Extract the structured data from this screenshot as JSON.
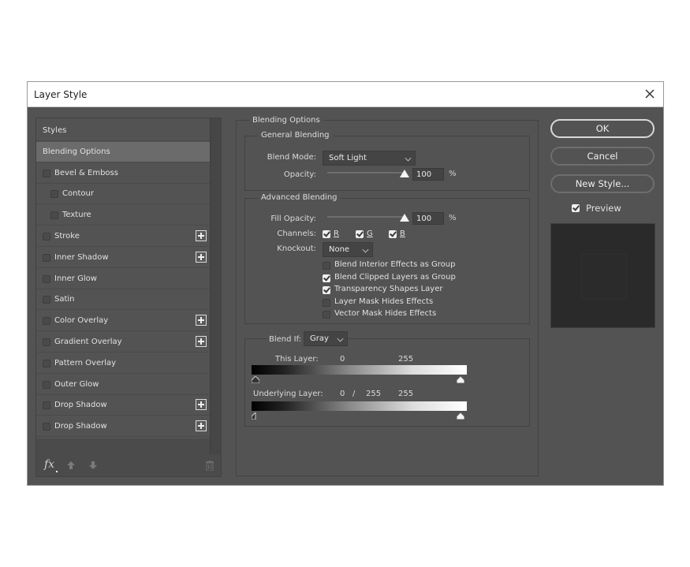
{
  "window": {
    "title": "Layer Style",
    "close_icon": "close-icon"
  },
  "styles_panel": {
    "items": [
      {
        "label": "Styles",
        "checkbox": false,
        "checked": false,
        "plus": false,
        "indent": 0,
        "selected": false
      },
      {
        "label": "Blending Options",
        "checkbox": false,
        "checked": false,
        "plus": false,
        "indent": 0,
        "selected": true
      },
      {
        "label": "Bevel & Emboss",
        "checkbox": true,
        "checked": false,
        "plus": false,
        "indent": 0,
        "selected": false
      },
      {
        "label": "Contour",
        "checkbox": true,
        "checked": false,
        "plus": false,
        "indent": 1,
        "selected": false
      },
      {
        "label": "Texture",
        "checkbox": true,
        "checked": false,
        "plus": false,
        "indent": 1,
        "selected": false
      },
      {
        "label": "Stroke",
        "checkbox": true,
        "checked": false,
        "plus": true,
        "indent": 0,
        "selected": false
      },
      {
        "label": "Inner Shadow",
        "checkbox": true,
        "checked": false,
        "plus": true,
        "indent": 0,
        "selected": false
      },
      {
        "label": "Inner Glow",
        "checkbox": true,
        "checked": false,
        "plus": false,
        "indent": 0,
        "selected": false
      },
      {
        "label": "Satin",
        "checkbox": true,
        "checked": false,
        "plus": false,
        "indent": 0,
        "selected": false
      },
      {
        "label": "Color Overlay",
        "checkbox": true,
        "checked": false,
        "plus": true,
        "indent": 0,
        "selected": false
      },
      {
        "label": "Gradient Overlay",
        "checkbox": true,
        "checked": false,
        "plus": true,
        "indent": 0,
        "selected": false
      },
      {
        "label": "Pattern Overlay",
        "checkbox": true,
        "checked": false,
        "plus": false,
        "indent": 0,
        "selected": false
      },
      {
        "label": "Outer Glow",
        "checkbox": true,
        "checked": false,
        "plus": false,
        "indent": 0,
        "selected": false
      },
      {
        "label": "Drop Shadow",
        "checkbox": true,
        "checked": false,
        "plus": true,
        "indent": 0,
        "selected": false
      },
      {
        "label": "Drop Shadow",
        "checkbox": true,
        "checked": false,
        "plus": true,
        "indent": 0,
        "selected": false
      }
    ],
    "footer": {
      "fx_label": "fx",
      "move_up_icon": "arrow-up-icon",
      "move_down_icon": "arrow-down-icon",
      "delete_icon": "trash-icon"
    }
  },
  "blending_options": {
    "legend": "Blending Options",
    "general": {
      "legend": "General Blending",
      "blend_mode_label": "Blend Mode:",
      "blend_mode_value": "Soft Light",
      "opacity_label": "Opacity:",
      "opacity_value": "100",
      "opacity_fraction": 1.0,
      "percent": "%"
    },
    "advanced": {
      "legend": "Advanced Blending",
      "fill_opacity_label": "Fill Opacity:",
      "fill_opacity_value": "100",
      "fill_opacity_fraction": 1.0,
      "percent": "%",
      "channels_label": "Channels:",
      "channels": [
        {
          "label": "R",
          "checked": true
        },
        {
          "label": "G",
          "checked": true
        },
        {
          "label": "B",
          "checked": true
        }
      ],
      "knockout_label": "Knockout:",
      "knockout_value": "None",
      "options": [
        {
          "label": "Blend Interior Effects as Group",
          "checked": false
        },
        {
          "label": "Blend Clipped Layers as Group",
          "checked": true
        },
        {
          "label": "Transparency Shapes Layer",
          "checked": true
        },
        {
          "label": "Layer Mask Hides Effects",
          "checked": false
        },
        {
          "label": "Vector Mask Hides Effects",
          "checked": false
        }
      ]
    },
    "blend_if": {
      "label": "Blend If:",
      "value": "Gray",
      "this_layer_label": "This Layer:",
      "this_layer_low": "0",
      "this_layer_high": "255",
      "underlying_label": "Underlying Layer:",
      "underlying_low": "0",
      "underlying_sep": "/",
      "underlying_low2": "255",
      "underlying_high": "255"
    }
  },
  "actions": {
    "ok_label": "OK",
    "cancel_label": "Cancel",
    "new_style_label": "New Style...",
    "preview_label": "Preview",
    "preview_checked": true
  }
}
